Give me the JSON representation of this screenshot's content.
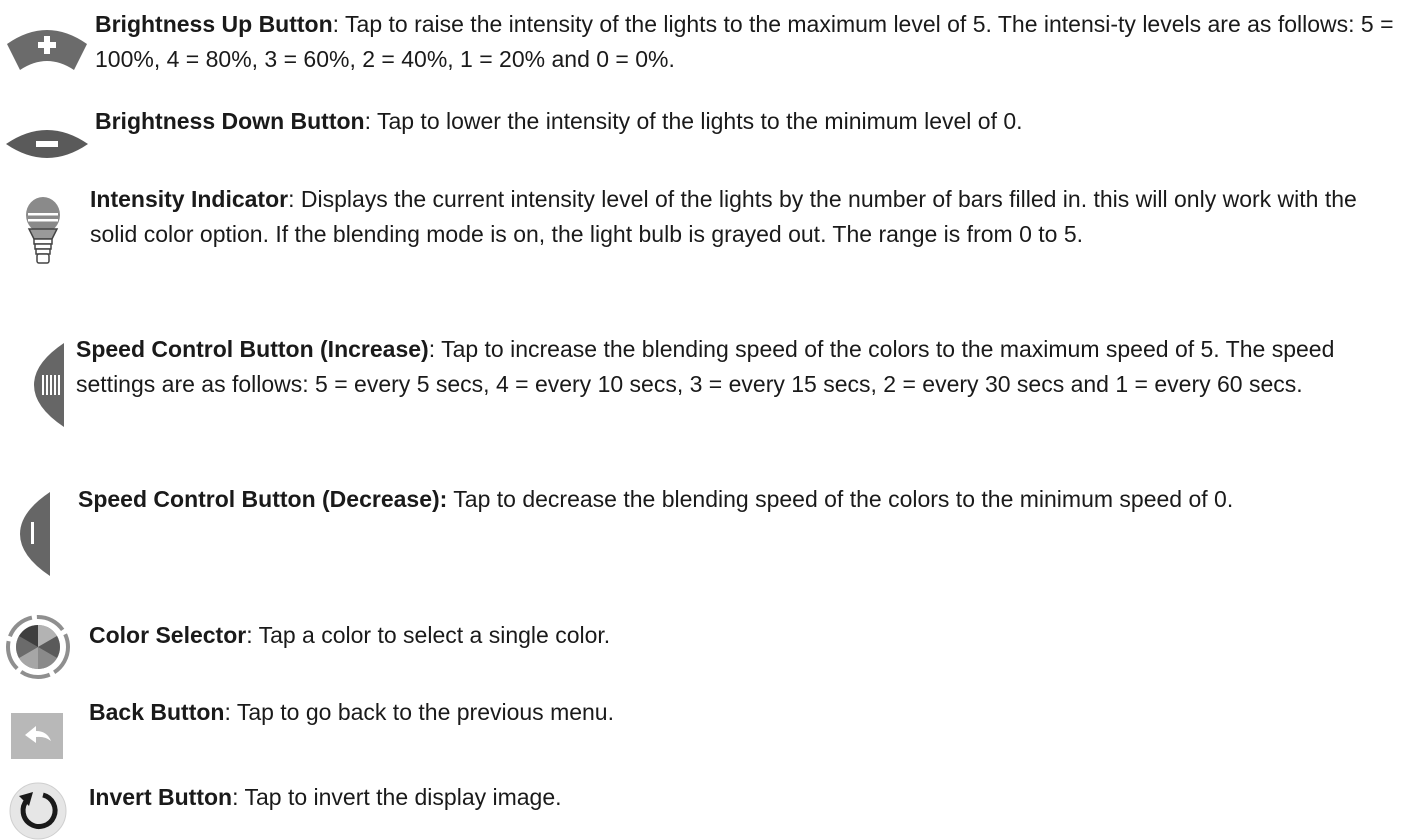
{
  "entries": [
    {
      "title": "Brightness Up Button",
      "text": ": Tap to raise the intensity of the lights to the maximum level of 5. The intensi-ty levels are as follows: 5 = 100%, 4 = 80%, 3 = 60%, 2 = 40%, 1 = 20% and 0 = 0%.",
      "icon": "brightness-up-icon"
    },
    {
      "title": "Brightness Down Button",
      "text": ": Tap to lower the intensity of the lights to the minimum level of 0.",
      "icon": "brightness-down-icon"
    },
    {
      "title": "Intensity Indicator",
      "text": ": Displays the current intensity level of the lights by the number of bars filled in. this will only work with the solid color option. If the blending mode is on, the light bulb is grayed out. The range is from 0 to 5.",
      "icon": "light-bulb-icon"
    },
    {
      "title": "Speed Control Button (Increase)",
      "text": ": Tap to increase the blending speed of the colors to the maximum speed of 5. The speed settings are as follows: 5 = every 5 secs, 4 = every 10 secs, 3 = every 15 secs, 2 = every 30 secs and 1 = every 60 secs.",
      "icon": "speed-increase-icon"
    },
    {
      "title": "Speed Control Button (Decrease):",
      "text": " Tap to decrease the blending speed of the colors to the minimum speed of 0.",
      "icon": "speed-decrease-icon"
    },
    {
      "title": "Color Selector",
      "text": ": Tap a color to select a single color.",
      "icon": "color-wheel-icon"
    },
    {
      "title": "Back Button",
      "text": ": Tap to go back to the previous menu.",
      "icon": "back-arrow-icon"
    },
    {
      "title": "Invert Button",
      "text": ": Tap to invert the display image.",
      "icon": "rotate-icon"
    }
  ]
}
